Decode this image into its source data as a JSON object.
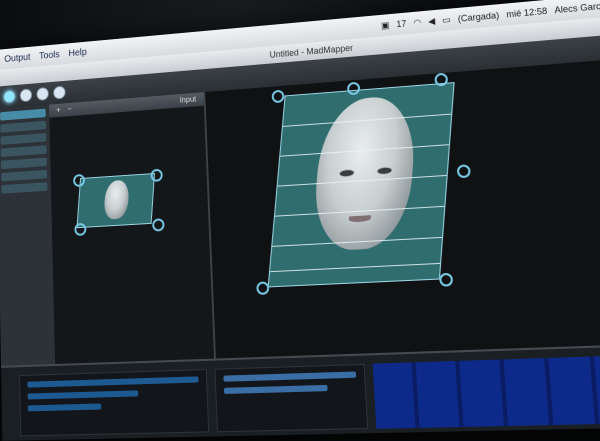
{
  "menubar": {
    "items": [
      "Output",
      "Tools",
      "Help"
    ],
    "status_code": "17",
    "battery": "(Cargada)",
    "clock": "mié 12:58",
    "user": "Alecs García Sauri"
  },
  "window": {
    "title": "Untitled - MadMapper"
  },
  "input_panel": {
    "label": "Input"
  },
  "colors": {
    "accent": "#79c9e6",
    "quad_fill": "#2f6d6f",
    "toolbar": "#3b4147"
  }
}
